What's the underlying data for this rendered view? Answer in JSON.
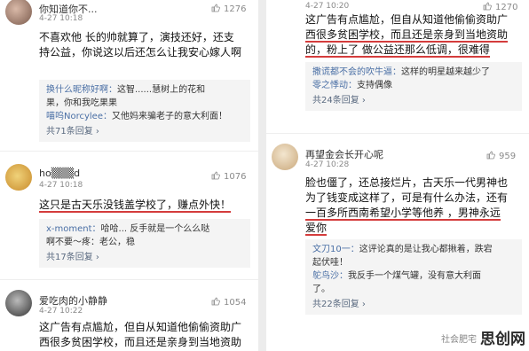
{
  "left": {
    "post1": {
      "username": "你知道你不...",
      "date": "4-27 10:18",
      "likes": "1276",
      "lines": [
        "不喜欢他 长的帅就算了，演技还好，还支",
        "持公益，你说这以后还怎么让我安心嫁人啊"
      ],
      "replies": [
        {
          "name": "换什么昵称好啊：",
          "text": "这智......慧树上的花和"
        },
        {
          "name": "",
          "text": "果，你和我吃果果"
        },
        {
          "name": "喵呜Norcylee：",
          "text": "又他妈来骗老子的意大利面！"
        }
      ],
      "more": "共71条回复 ›"
    },
    "post2": {
      "username": "ho▒▒▒d",
      "date": "4-27 10:18",
      "likes": "1076",
      "lines": [
        "这只是古天乐没钱盖学校了，赚点外快！"
      ],
      "replies": [
        {
          "name": "x-moment：",
          "text": "哈哈...   反手就是一个么么哒"
        },
        {
          "name": "",
          "text": "啊不要～疼：老公，稳"
        }
      ],
      "more": "共17条回复 ›"
    },
    "post3": {
      "username": "爱吃肉的小静静",
      "date": "4-27 10:22",
      "likes": "1054",
      "lines": [
        "这广告有点尴尬，但自从知道他偷偷资助广",
        "西很多贫困学校，而且还是亲身到当地资助"
      ]
    }
  },
  "right": {
    "post1": {
      "username": "",
      "date": "4-27 10:20",
      "likes": "1270",
      "lines": [
        "这广告有点尴尬，但自从知道他偷偷资助广",
        "西很多贫困学校，而且还是亲身到当地资助",
        "的，粉上了 做公益还那么低调，很难得"
      ],
      "replies": [
        {
          "name": "撒谎都不会的吹牛逼：",
          "text": "这样的明星越来越少了"
        },
        {
          "name": "零之悸动：",
          "text": "支持偶像"
        }
      ],
      "more": "共24条回复 ›"
    },
    "post2": {
      "username": "再望金会长开心呢",
      "date": "4-27 10:28",
      "likes": "959",
      "lines": [
        "脸也僵了，还总接烂片，古天乐一代男神也",
        "为了钱变成这样了，可是有什么办法，还有",
        "一百多所西南希望小学等他养 ，男神永远",
        "爱你"
      ],
      "replies": [
        {
          "name": "文刀10一：",
          "text": "这评论真的是让我心都揪着，跌宕"
        },
        {
          "name": "",
          "text": "起伏哇！"
        },
        {
          "name": "鸵鸟沙：",
          "text": "我反手一个煤气罐，没有意大利面"
        },
        {
          "name": "",
          "text": "了。"
        }
      ],
      "more": "共22条回复 ›"
    }
  },
  "watermark": {
    "small": "社会肥宅",
    "brand": "思创网"
  }
}
